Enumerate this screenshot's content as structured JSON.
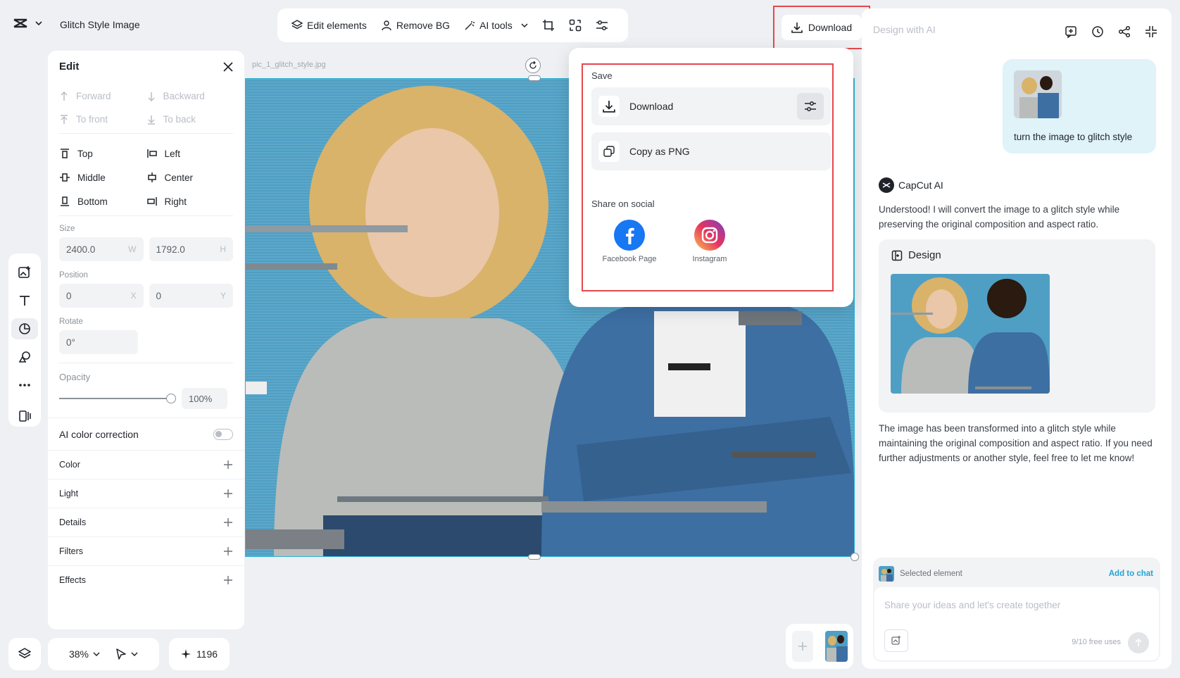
{
  "app": {
    "title": "Glitch Style Image"
  },
  "toolbar": {
    "edit_elements": "Edit elements",
    "remove_bg": "Remove BG",
    "ai_tools": "AI tools",
    "download": "Download"
  },
  "edit_panel": {
    "title": "Edit",
    "arrange": {
      "forward": "Forward",
      "backward": "Backward",
      "to_front": "To front",
      "to_back": "To back"
    },
    "align": {
      "top": "Top",
      "left": "Left",
      "middle": "Middle",
      "center": "Center",
      "bottom": "Bottom",
      "right": "Right"
    },
    "size_label": "Size",
    "width": "2400.0",
    "w_unit": "W",
    "height": "1792.0",
    "h_unit": "H",
    "position_label": "Position",
    "pos_x": "0",
    "x_unit": "X",
    "pos_y": "0",
    "y_unit": "Y",
    "rotate_label": "Rotate",
    "rotate": "0°",
    "opacity_label": "Opacity",
    "opacity": "100%",
    "ai_color_correction": "AI color correction",
    "sections": [
      "Color",
      "Light",
      "Details",
      "Filters",
      "Effects"
    ]
  },
  "canvas": {
    "file_name": "pic_1_glitch_style.jpg"
  },
  "bottom": {
    "zoom": "38%",
    "credits": "1196"
  },
  "download_popup": {
    "save_label": "Save",
    "download": "Download",
    "copy_png": "Copy as PNG",
    "share_label": "Share on social",
    "facebook": "Facebook Page",
    "instagram": "Instagram"
  },
  "chat": {
    "header": "Design with AI",
    "user_message": "turn the image to glitch style",
    "ai_name": "CapCut AI",
    "ai_reply_1": "Understood! I will convert the image to a glitch style while preserving the original composition and aspect ratio.",
    "design_label": "Design",
    "ai_reply_2": "The image has been transformed into a glitch style while maintaining the original composition and aspect ratio. If you need further adjustments or another style, feel free to let me know!",
    "selected_element": "Selected element",
    "add_to_chat": "Add to chat",
    "input_placeholder": "Share your ideas and let's create together",
    "free_uses": "9/10 free uses"
  },
  "colors": {
    "accent": "#21a4d6",
    "highlight": "#e5484d",
    "facebook": "#1877f2"
  }
}
